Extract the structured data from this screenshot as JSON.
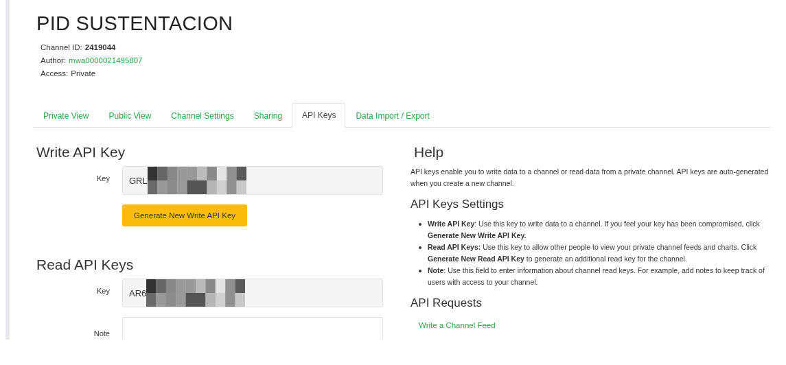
{
  "channel": {
    "title": "PID SUSTENTACION",
    "meta": [
      {
        "kind": "bold",
        "label": "Channel ID:",
        "value": "2419044"
      },
      {
        "kind": "link",
        "label": "Author:",
        "value": "mwa0000021495807"
      },
      {
        "kind": "plain",
        "label": "Access:",
        "value": "Private"
      }
    ]
  },
  "tabs": [
    {
      "label": "Private View",
      "selected": false
    },
    {
      "label": "Public View",
      "selected": false
    },
    {
      "label": "Channel Settings",
      "selected": false
    },
    {
      "label": "Sharing",
      "selected": false
    },
    {
      "label": "API Keys",
      "selected": true
    },
    {
      "label": "Data Import / Export",
      "selected": false
    }
  ],
  "write_key": {
    "heading": "Write API Key",
    "label": "Key",
    "value": "GRL",
    "button": "Generate New Write API Key"
  },
  "read_keys": {
    "heading": "Read API Keys",
    "label": "Key",
    "value": "AR6",
    "note_label": "Note"
  },
  "help": {
    "heading": "Help",
    "text": "API keys enable you to write data to a channel or read data from a private channel. API keys are auto-generated when you create a new channel.",
    "settings_heading": "API Keys Settings",
    "bullets": [
      "**Write API Key**: Use this key to write data to a channel. If you feel your key has been compromised, click **Generate New Write API Key.**",
      "**Read API Keys:** Use this key to allow other people to view your private channel feeds and charts. Click **Generate New Read API Key** to generate an additional read key for the channel.",
      "**Note**: Use this field to enter information about channel read keys. For example, add notes to keep track of users with access to your channel."
    ],
    "requests_heading": "API Requests",
    "links": [
      "Write a Channel Feed"
    ]
  }
}
